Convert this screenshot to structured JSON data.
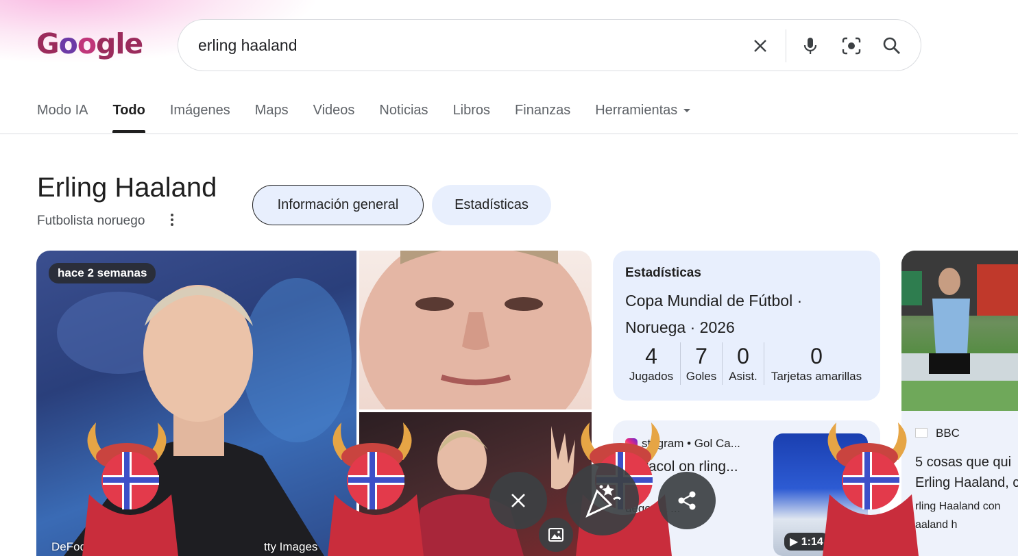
{
  "header": {
    "logo_letters": [
      "G",
      "o",
      "o",
      "g",
      "l",
      "e"
    ],
    "search_query": "erling haaland"
  },
  "tabs": [
    {
      "label": "Modo IA"
    },
    {
      "label": "Todo"
    },
    {
      "label": "Imágenes"
    },
    {
      "label": "Maps"
    },
    {
      "label": "Videos"
    },
    {
      "label": "Noticias"
    },
    {
      "label": "Libros"
    },
    {
      "label": "Finanzas"
    },
    {
      "label": "Herramientas"
    }
  ],
  "entity": {
    "title": "Erling Haaland",
    "subtitle": "Futbolista noruego",
    "chips": [
      "Información general",
      "Estadísticas"
    ]
  },
  "photos": {
    "time_badge": "hace 2 semanas",
    "credit_left": "DeFodi I",
    "credit_right": "tty Images"
  },
  "stats": {
    "heading": "Estadísticas",
    "competition": "Copa Mundial de Fútbol · Noruega · 2026",
    "items": [
      {
        "value": "4",
        "label": "Jugados"
      },
      {
        "value": "7",
        "label": "Goles"
      },
      {
        "value": "0",
        "label": "Asist."
      },
      {
        "value": "0",
        "label": "Tarjetas amarillas"
      }
    ]
  },
  "instagram": {
    "source": "stagram • Gol Ca...",
    "title": "Caracol on rling...",
    "snippet": "uego ba ...",
    "duration": "1:14"
  },
  "news": {
    "source": "BBC",
    "headline_1": "5 cosas que qui",
    "headline_2": "Erling Haaland, c",
    "snippet_1": "rling Haaland con",
    "snippet_2": "aaland h"
  },
  "colors": {
    "accent_chip": "#e8effd",
    "logo": "#8c2a5a"
  }
}
